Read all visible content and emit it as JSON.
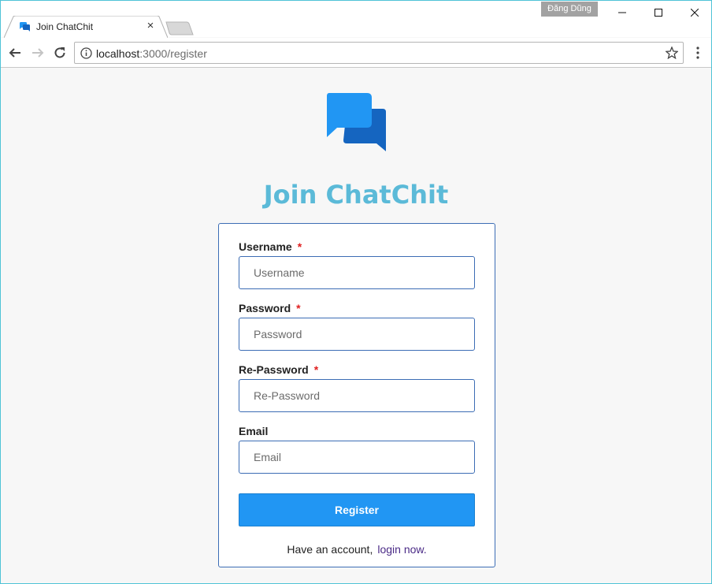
{
  "browser": {
    "tab_title": "Join ChatChit",
    "tab_close": "×",
    "profile_name": "Đăng Dũng",
    "url_host": "localhost",
    "url_path": ":3000/register"
  },
  "page": {
    "heading": "Join ChatChit",
    "brand_colors": {
      "heading": "#5bbad8",
      "primary": "#2196f3",
      "border": "#3c6db5"
    }
  },
  "form": {
    "username": {
      "label": "Username",
      "required_mark": "*",
      "placeholder": "Username",
      "value": ""
    },
    "password": {
      "label": "Password",
      "required_mark": "*",
      "placeholder": "Password",
      "value": ""
    },
    "repassword": {
      "label": "Re-Password",
      "required_mark": "*",
      "placeholder": "Re-Password",
      "value": ""
    },
    "email": {
      "label": "Email",
      "placeholder": "Email",
      "value": ""
    },
    "submit_label": "Register",
    "footer_text": "Have an account,",
    "footer_link": "login now."
  },
  "icons": [
    "chat-favicon-icon",
    "close-icon",
    "back-arrow-icon",
    "forward-arrow-icon",
    "reload-icon",
    "info-icon",
    "star-icon",
    "menu-dots-icon",
    "chat-logo-icon",
    "minimize-icon",
    "maximize-icon",
    "window-close-icon"
  ]
}
